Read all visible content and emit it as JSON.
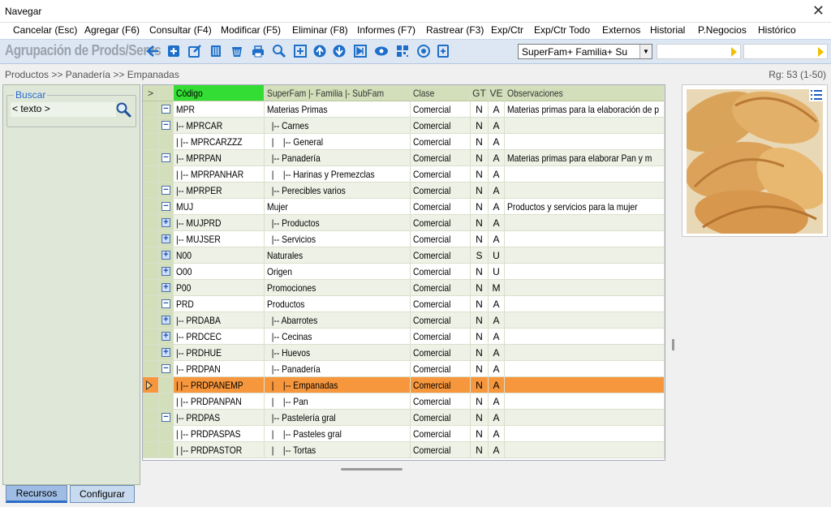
{
  "window": {
    "title": "Navegar",
    "close_glyph": "✕"
  },
  "menu": [
    "Cancelar (Esc)",
    "Agregar (F6)",
    "Consultar (F4)",
    "Modificar (F5)",
    "Eliminar (F8)",
    "Informes (F7)",
    "Rastrear (F3)",
    "Exp/Ctr",
    "Exp/Ctr Todo",
    "Externos",
    "Historial",
    "P.Negocios",
    "Histórico"
  ],
  "toolbar": {
    "app_title": "Agrupación de Prods/Servs",
    "icons": [
      "back-arrow-icon",
      "add-icon",
      "edit-icon",
      "book-icon",
      "delete-bin-icon",
      "print-icon",
      "search-zoom-icon",
      "expand-icon",
      "up-circle-icon",
      "down-circle-icon",
      "last-icon",
      "view-eye-icon",
      "barcode-icon",
      "settings-target-icon",
      "refresh-icon"
    ],
    "view_select": "SuperFam+ Familia+ Su",
    "accent": "#1d6fc9"
  },
  "breadcrumb": "Productos >> Panadería >> Empanadas",
  "record_info": "Rg: 53 (1-50)",
  "search": {
    "legend": "Buscar",
    "placeholder": "< texto >"
  },
  "tabs": {
    "resources": "Recursos",
    "configure": "Configurar"
  },
  "grid": {
    "headers": {
      "ptr": ">",
      "codigo": "Código",
      "superfam": "SuperFam  |- Familia  |- SubFam",
      "clase": "Clase",
      "gt": "GT",
      "ve": "VE",
      "obs": "Observaciones"
    },
    "rows": [
      {
        "exp": "minus",
        "code": "MPR",
        "sf": "Materias Primas",
        "clase": "Comercial",
        "gt": "N",
        "ve": "A",
        "obs": "Materias primas para la elaboración de p"
      },
      {
        "exp": "minus",
        "code": "|-- MPRCAR",
        "sf": "  |-- Carnes",
        "clase": "Comercial",
        "gt": "N",
        "ve": "A",
        "obs": ""
      },
      {
        "exp": "",
        "code": "|    |-- MPRCARZZZ",
        "sf": "  |    |-- General",
        "clase": "Comercial",
        "gt": "N",
        "ve": "A",
        "obs": ""
      },
      {
        "exp": "minus",
        "code": "|-- MPRPAN",
        "sf": "  |-- Panadería",
        "clase": "Comercial",
        "gt": "N",
        "ve": "A",
        "obs": "Materias primas para elaborar Pan y m"
      },
      {
        "exp": "",
        "code": "|    |-- MPRPANHAR",
        "sf": "  |    |-- Harinas y Premezclas",
        "clase": "Comercial",
        "gt": "N",
        "ve": "A",
        "obs": ""
      },
      {
        "exp": "minus",
        "code": "|-- MPRPER",
        "sf": "  |-- Perecibles varios",
        "clase": "Comercial",
        "gt": "N",
        "ve": "A",
        "obs": ""
      },
      {
        "exp": "minus",
        "code": "MUJ",
        "sf": "Mujer",
        "clase": "Comercial",
        "gt": "N",
        "ve": "A",
        "obs": "Productos y servicios para la mujer"
      },
      {
        "exp": "plus",
        "code": "|-- MUJPRD",
        "sf": "  |-- Productos",
        "clase": "Comercial",
        "gt": "N",
        "ve": "A",
        "obs": ""
      },
      {
        "exp": "plus",
        "code": "|-- MUJSER",
        "sf": "  |-- Servicios",
        "clase": "Comercial",
        "gt": "N",
        "ve": "A",
        "obs": ""
      },
      {
        "exp": "plus",
        "code": "N00",
        "sf": "Naturales",
        "clase": "Comercial",
        "gt": "S",
        "ve": "U",
        "obs": ""
      },
      {
        "exp": "plus",
        "code": "O00",
        "sf": "Origen",
        "clase": "Comercial",
        "gt": "N",
        "ve": "U",
        "obs": ""
      },
      {
        "exp": "plus",
        "code": "P00",
        "sf": "Promociones",
        "clase": "Comercial",
        "gt": "N",
        "ve": "M",
        "obs": ""
      },
      {
        "exp": "minus",
        "code": "PRD",
        "sf": "Productos",
        "clase": "Comercial",
        "gt": "N",
        "ve": "A",
        "obs": ""
      },
      {
        "exp": "plus",
        "code": "|-- PRDABA",
        "sf": "  |-- Abarrotes",
        "clase": "Comercial",
        "gt": "N",
        "ve": "A",
        "obs": ""
      },
      {
        "exp": "plus",
        "code": "|-- PRDCEC",
        "sf": "  |-- Cecinas",
        "clase": "Comercial",
        "gt": "N",
        "ve": "A",
        "obs": ""
      },
      {
        "exp": "plus",
        "code": "|-- PRDHUE",
        "sf": "  |-- Huevos",
        "clase": "Comercial",
        "gt": "N",
        "ve": "A",
        "obs": ""
      },
      {
        "exp": "minus",
        "code": "|-- PRDPAN",
        "sf": "  |-- Panadería",
        "clase": "Comercial",
        "gt": "N",
        "ve": "A",
        "obs": ""
      },
      {
        "exp": "",
        "code": "|    |-- PRDPANEMP",
        "sf": "  |    |-- Empanadas",
        "clase": "Comercial",
        "gt": "N",
        "ve": "A",
        "obs": "",
        "selected": true
      },
      {
        "exp": "",
        "code": "|    |-- PRDPANPAN",
        "sf": "  |    |-- Pan",
        "clase": "Comercial",
        "gt": "N",
        "ve": "A",
        "obs": ""
      },
      {
        "exp": "minus",
        "code": "|-- PRDPAS",
        "sf": "  |-- Pastelería gral",
        "clase": "Comercial",
        "gt": "N",
        "ve": "A",
        "obs": ""
      },
      {
        "exp": "",
        "code": "|    |-- PRDPASPAS",
        "sf": "  |    |-- Pasteles gral",
        "clase": "Comercial",
        "gt": "N",
        "ve": "A",
        "obs": ""
      },
      {
        "exp": "",
        "code": "|    |-- PRDPASTOR",
        "sf": "  |    |-- Tortas",
        "clase": "Comercial",
        "gt": "N",
        "ve": "A",
        "obs": ""
      }
    ]
  }
}
